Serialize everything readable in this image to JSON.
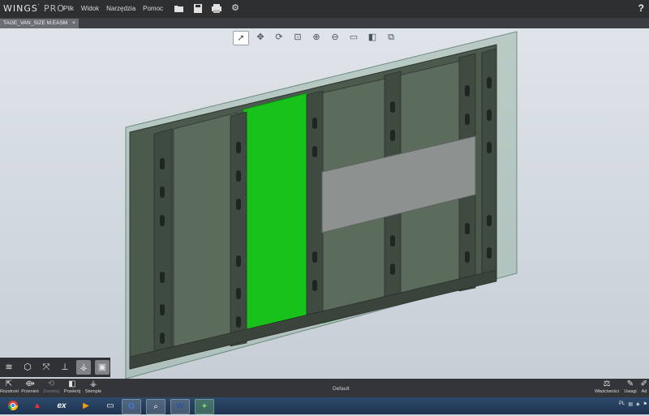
{
  "app": {
    "logo_text": "WINGS",
    "logo_suffix": "PRO"
  },
  "menu": {
    "items": [
      "Plik",
      "Widok",
      "Narzędzia",
      "Pomoc"
    ]
  },
  "toolbar": {
    "icons": [
      "open-folder-icon",
      "save-icon",
      "print-icon",
      "settings-icon"
    ],
    "help_label": "?"
  },
  "document_tab": {
    "label": "TAGE_VAN_SIZE M.EASM",
    "close_label": "×"
  },
  "view_tools": [
    {
      "name": "select-cursor-icon",
      "glyph": "➚"
    },
    {
      "name": "pan-icon",
      "glyph": "✥"
    },
    {
      "name": "rotate-icon",
      "glyph": "⟳"
    },
    {
      "name": "zoom-area-icon",
      "glyph": "⊡"
    },
    {
      "name": "zoom-fit-icon",
      "glyph": "⊕"
    },
    {
      "name": "zoom-icon",
      "glyph": "⊖"
    },
    {
      "name": "display-mode-icon",
      "glyph": "▭"
    },
    {
      "name": "section-icon",
      "glyph": "◧"
    },
    {
      "name": "view-cube-icon",
      "glyph": "⧉"
    }
  ],
  "left_tools": [
    "layers-icon",
    "cube-icon",
    "explode-icon",
    "pin-icon",
    "stamp-tool-icon",
    "box-icon"
  ],
  "bottom_tools": [
    {
      "name": "explode-tool",
      "label": "Rozstrzel",
      "glyph": "⇱",
      "enabled": true
    },
    {
      "name": "move-tool",
      "label": "Przenieś",
      "glyph": "⟴",
      "enabled": true
    },
    {
      "name": "reset-tool",
      "label": "Zresetuj",
      "glyph": "⟲",
      "enabled": false
    },
    {
      "name": "section-tool",
      "label": "Przekrój",
      "glyph": "◧",
      "enabled": true
    },
    {
      "name": "stamp-tool",
      "label": "Stemple",
      "glyph": "⚶",
      "enabled": true
    }
  ],
  "status": {
    "view_name": "Default"
  },
  "right_tools": [
    {
      "name": "properties-tool",
      "label": "Właściwości",
      "glyph": "⚖"
    },
    {
      "name": "notes-tool",
      "label": "Uwagi",
      "glyph": "✎"
    },
    {
      "name": "more-tool",
      "label": "Ad",
      "glyph": "✐"
    }
  ],
  "taskbar": {
    "apps": [
      "chrome-icon",
      "acrobat-icon",
      "excel-icon",
      "media-player-icon",
      "monitor-icon",
      "outlook-icon",
      "search-app-icon",
      "word-icon",
      "wings-app-icon"
    ],
    "tray_lang": "PL"
  }
}
